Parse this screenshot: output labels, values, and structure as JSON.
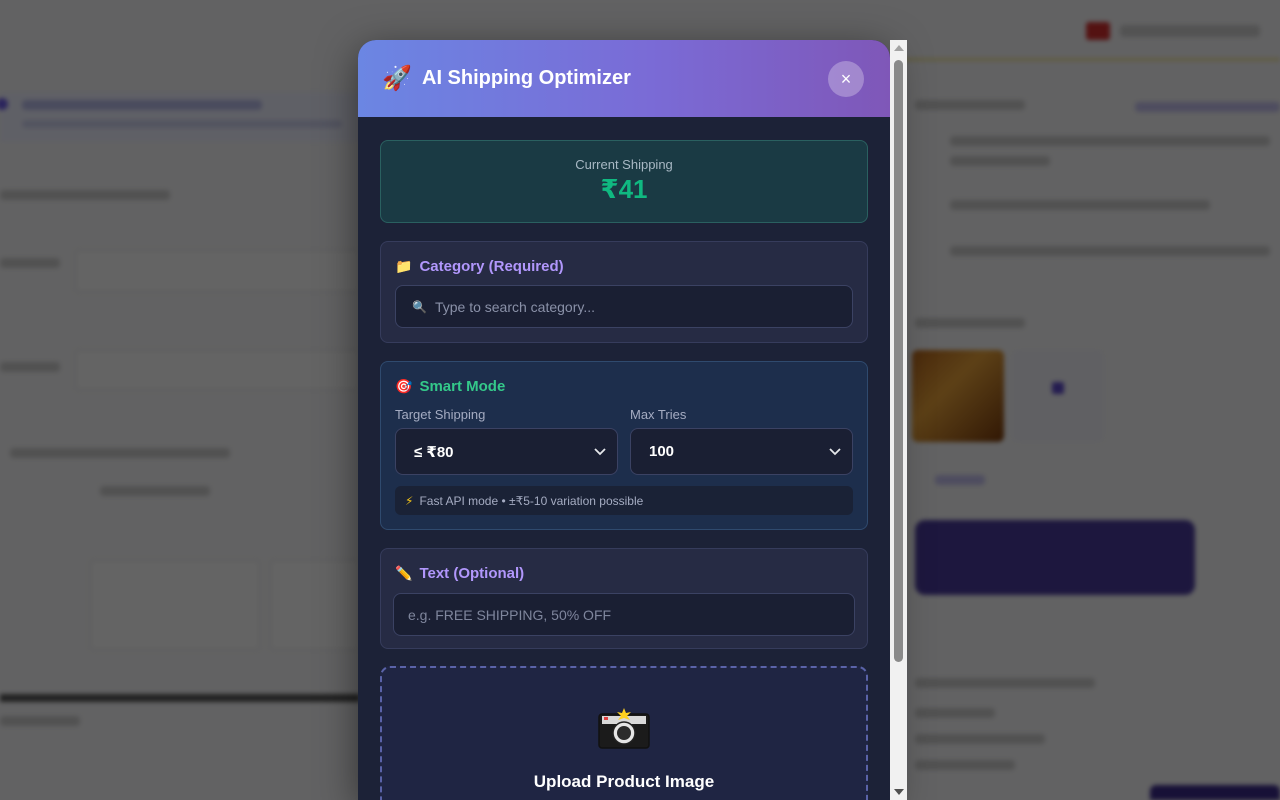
{
  "modal": {
    "title": "AI Shipping Optimizer",
    "title_icon": "🚀",
    "close_label": "×"
  },
  "shipping": {
    "label": "Current Shipping",
    "value": "₹41"
  },
  "category": {
    "icon": "📁",
    "heading": "Category (Required)",
    "placeholder": "Type to search category...",
    "value": ""
  },
  "smart_mode": {
    "icon": "🎯",
    "heading": "Smart Mode",
    "target_label": "Target Shipping",
    "target_value": "≤ ₹80",
    "max_tries_label": "Max Tries",
    "max_tries_value": "100",
    "hint_icon": "⚡",
    "hint": "Fast API mode • ±₹5-10 variation possible"
  },
  "text_section": {
    "icon": "✏️",
    "heading": "Text (Optional)",
    "placeholder": "e.g. FREE SHIPPING, 50% OFF",
    "value": ""
  },
  "upload": {
    "icon": "📸",
    "label": "Upload Product Image"
  },
  "colors": {
    "accent_purple": "#b197fc",
    "accent_green": "#10b981",
    "header_gradient_start": "#6b86e3",
    "header_gradient_end": "#7f57b8",
    "modal_bg": "#1c2237"
  }
}
